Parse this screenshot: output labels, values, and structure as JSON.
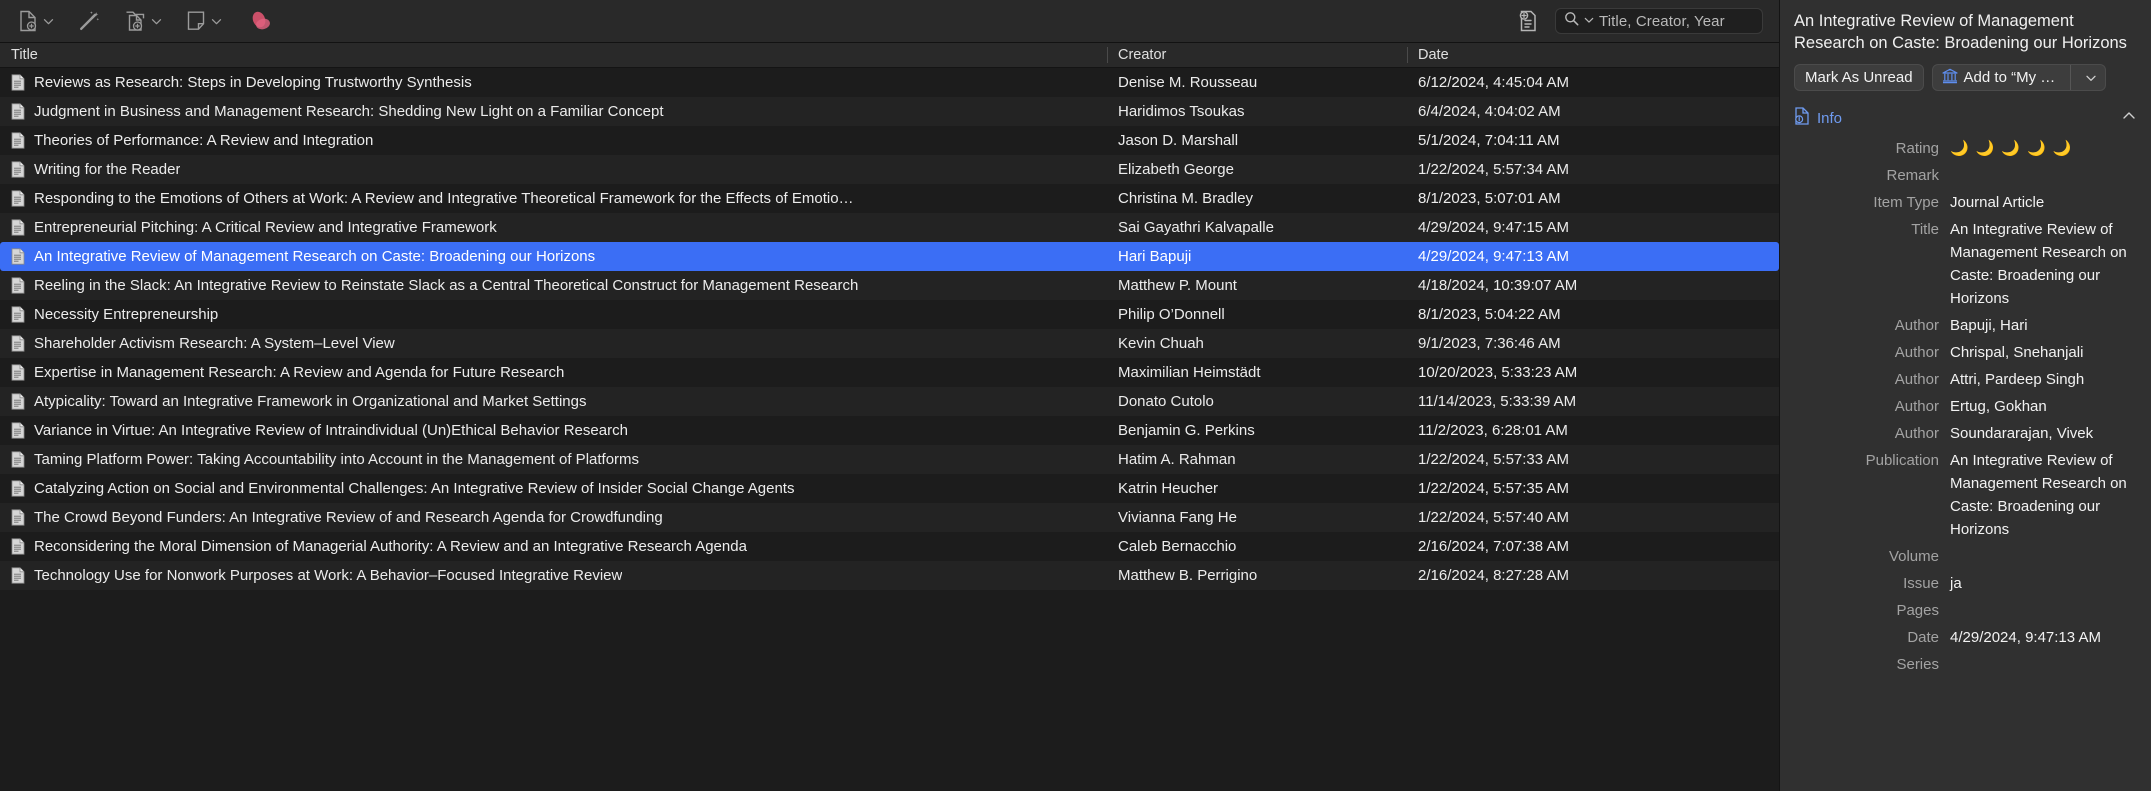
{
  "toolbar": {
    "buttons": [
      {
        "name": "new-item",
        "icon": "new-document-icon",
        "has_chevron": true
      },
      {
        "name": "add-by-identifier",
        "icon": "magic-wand-icon",
        "has_chevron": false
      },
      {
        "name": "add-attachment",
        "icon": "add-attachment-icon",
        "has_chevron": true
      },
      {
        "name": "new-note",
        "icon": "new-note-icon",
        "has_chevron": true
      }
    ],
    "logo_label": "app-logo",
    "locate_label": "locate-icon"
  },
  "search": {
    "placeholder": "Title, Creator, Year",
    "icon": "search-icon",
    "chevron": "chevron-down-icon"
  },
  "table": {
    "columns": [
      "Title",
      "Creator",
      "Date"
    ],
    "rows": [
      {
        "title": "Reviews as Research: Steps in Developing Trustworthy Synthesis",
        "creator": "Denise M. Rousseau",
        "date": "6/12/2024, 4:45:04 AM",
        "selected": false
      },
      {
        "title": "Judgment in Business and Management Research: Shedding New Light on a Familiar Concept",
        "creator": "Haridimos Tsoukas",
        "date": "6/4/2024, 4:04:02 AM",
        "selected": false
      },
      {
        "title": "Theories of Performance: A Review and Integration",
        "creator": "Jason D. Marshall",
        "date": "5/1/2024, 7:04:11 AM",
        "selected": false
      },
      {
        "title": "Writing for the Reader",
        "creator": "Elizabeth George",
        "date": "1/22/2024, 5:57:34 AM",
        "selected": false
      },
      {
        "title": "Responding to the Emotions of Others at Work: A Review and Integrative Theoretical Framework for the Effects of Emotio…",
        "creator": "Christina M. Bradley",
        "date": "8/1/2023, 5:07:01 AM",
        "selected": false
      },
      {
        "title": "Entrepreneurial Pitching: A Critical Review and Integrative Framework",
        "creator": "Sai Gayathri Kalvapalle",
        "date": "4/29/2024, 9:47:15 AM",
        "selected": false
      },
      {
        "title": "An Integrative Review of Management Research on Caste: Broadening our Horizons",
        "creator": "Hari Bapuji",
        "date": "4/29/2024, 9:47:13 AM",
        "selected": true
      },
      {
        "title": "Reeling in the Slack: An Integrative Review to Reinstate Slack as a Central Theoretical Construct for Management Research",
        "creator": "Matthew P. Mount",
        "date": "4/18/2024, 10:39:07 AM",
        "selected": false
      },
      {
        "title": "Necessity Entrepreneurship",
        "creator": "Philip O’Donnell",
        "date": "8/1/2023, 5:04:22 AM",
        "selected": false
      },
      {
        "title": "Shareholder Activism Research: A System–Level View",
        "creator": "Kevin Chuah",
        "date": "9/1/2023, 7:36:46 AM",
        "selected": false
      },
      {
        "title": "Expertise in Management Research: A Review and Agenda for Future Research",
        "creator": "Maximilian Heimstädt",
        "date": "10/20/2023, 5:33:23 AM",
        "selected": false
      },
      {
        "title": "Atypicality: Toward an Integrative Framework in Organizational and Market Settings",
        "creator": "Donato Cutolo",
        "date": "11/14/2023, 5:33:39 AM",
        "selected": false
      },
      {
        "title": "Variance in Virtue: An Integrative Review of Intraindividual (Un)Ethical Behavior Research",
        "creator": "Benjamin G. Perkins",
        "date": "11/2/2023, 6:28:01 AM",
        "selected": false
      },
      {
        "title": "Taming Platform Power: Taking Accountability into Account in the Management of Platforms",
        "creator": "Hatim A. Rahman",
        "date": "1/22/2024, 5:57:33 AM",
        "selected": false
      },
      {
        "title": "Catalyzing Action on Social and Environmental Challenges: An Integrative Review of Insider Social Change Agents",
        "creator": "Katrin Heucher",
        "date": "1/22/2024, 5:57:35 AM",
        "selected": false
      },
      {
        "title": "The Crowd Beyond Funders: An Integrative Review of and Research Agenda for Crowdfunding",
        "creator": "Vivianna Fang He",
        "date": "1/22/2024, 5:57:40 AM",
        "selected": false
      },
      {
        "title": "Reconsidering the Moral Dimension of Managerial Authority: A Review and an Integrative Research Agenda",
        "creator": "Caleb Bernacchio",
        "date": "2/16/2024, 7:07:38 AM",
        "selected": false
      },
      {
        "title": "Technology Use for Nonwork Purposes at Work: A Behavior–Focused Integrative Review",
        "creator": "Matthew B. Perrigino",
        "date": "2/16/2024, 8:27:28 AM",
        "selected": false
      }
    ]
  },
  "sidebar": {
    "item_title": "An Integrative Review of Management Research on Caste: Broadening our Horizons",
    "mark_unread_label": "Mark As Unread",
    "add_to_label": "Add to “My …",
    "library_icon": "library-building-icon",
    "collapse_icon": "chevron-up-icon",
    "info_section": {
      "label": "Info",
      "icon": "info-document-icon",
      "fields": [
        {
          "label": "Rating",
          "value": "",
          "type": "rating",
          "rating": 5,
          "rating_glyph": "🌙"
        },
        {
          "label": "Remark",
          "value": "",
          "type": "text"
        },
        {
          "label": "Item Type",
          "value": "Journal Article",
          "type": "text"
        },
        {
          "label": "Title",
          "value": "An Integrative Review of Management Research on Caste: Broadening our Horizons",
          "type": "text"
        },
        {
          "label": "Author",
          "value": "Bapuji, Hari",
          "type": "text"
        },
        {
          "label": "Author",
          "value": "Chrispal, Snehanjali",
          "type": "text"
        },
        {
          "label": "Author",
          "value": "Attri, Pardeep Singh",
          "type": "text"
        },
        {
          "label": "Author",
          "value": "Ertug, Gokhan",
          "type": "text"
        },
        {
          "label": "Author",
          "value": "Soundararajan, Vivek",
          "type": "text"
        },
        {
          "label": "Publication",
          "value": "An Integrative Review of Management Research on Caste: Broadening our Horizons",
          "type": "text"
        },
        {
          "label": "Volume",
          "value": "",
          "type": "text"
        },
        {
          "label": "Issue",
          "value": "ja",
          "type": "text"
        },
        {
          "label": "Pages",
          "value": "",
          "type": "text"
        },
        {
          "label": "Date",
          "value": "4/29/2024, 9:47:13 AM",
          "type": "text"
        },
        {
          "label": "Series",
          "value": "",
          "type": "text"
        }
      ]
    }
  },
  "colors": {
    "selection_blue": "#3b6ef5",
    "accent_blue": "#6f9bf0",
    "rating_gold": "#f3b24a",
    "logo_pink": "#e0617f"
  }
}
